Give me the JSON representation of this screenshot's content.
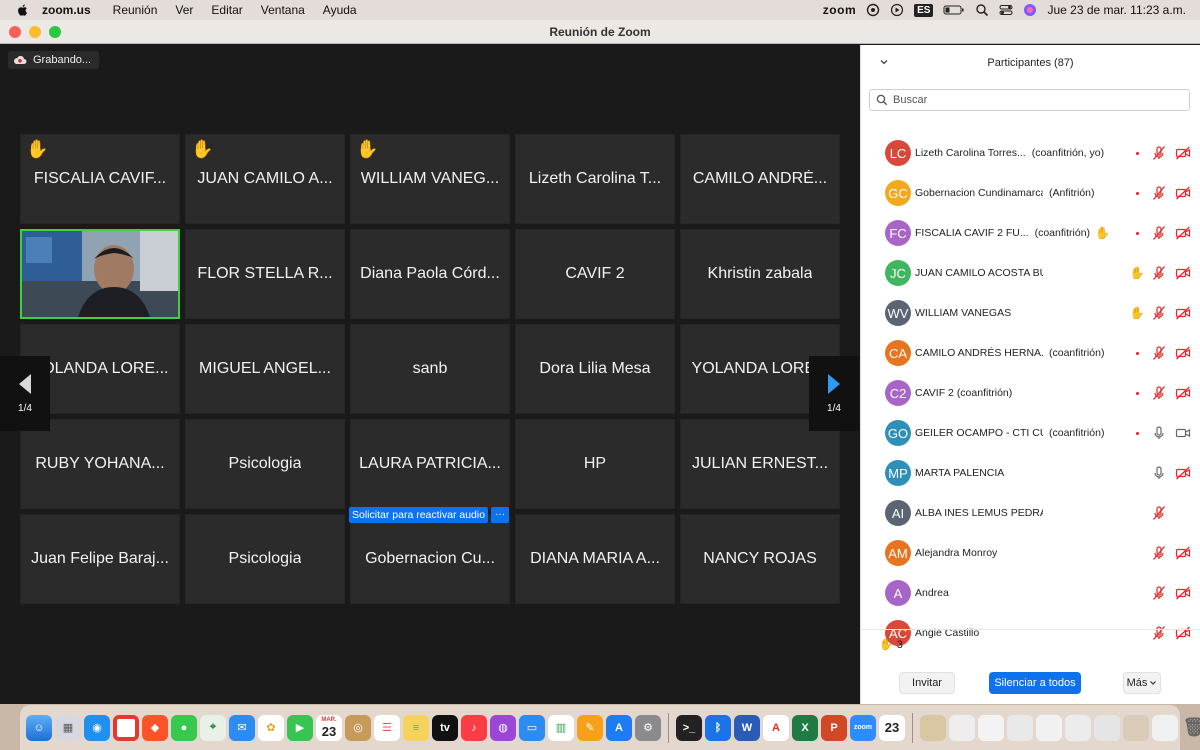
{
  "menubar": {
    "app": "zoom.us",
    "items": [
      "Reunión",
      "Ver",
      "Editar",
      "Ventana",
      "Ayuda"
    ],
    "status_zoom": "zoom",
    "input_lang": "ES",
    "datetime": "Jue 23 de mar.  11:23 a.m."
  },
  "window": {
    "title": "Reunión de Zoom",
    "recording_label": "Grabando..."
  },
  "grid": {
    "tiles": [
      {
        "name": "FISCALIA CAVIF...",
        "hand": true
      },
      {
        "name": "JUAN CAMILO A...",
        "hand": true
      },
      {
        "name": "WILLIAM VANEG...",
        "hand": true
      },
      {
        "name": "Lizeth Carolina T...",
        "hand": false
      },
      {
        "name": "CAMILO ANDRÉ...",
        "hand": false
      },
      {
        "name": "",
        "video": true
      },
      {
        "name": "FLOR STELLA R...",
        "hand": false
      },
      {
        "name": "Diana Paola Córd...",
        "hand": false
      },
      {
        "name": "CAVIF 2",
        "hand": false
      },
      {
        "name": "Khristin zabala",
        "hand": false
      },
      {
        "name": "YOLANDA LORE...",
        "hand": false
      },
      {
        "name": "MIGUEL ANGEL...",
        "hand": false
      },
      {
        "name": "sanb",
        "hand": false
      },
      {
        "name": "Dora Lilia Mesa",
        "hand": false
      },
      {
        "name": "YOLANDA LORE...",
        "hand": false
      },
      {
        "name": "RUBY YOHANA...",
        "hand": false
      },
      {
        "name": "Psicologia",
        "hand": false
      },
      {
        "name": "LAURA PATRICIA...",
        "hand": false
      },
      {
        "name": "HP",
        "hand": false
      },
      {
        "name": "JULIAN ERNEST...",
        "hand": false
      },
      {
        "name": "Juan Felipe Baraj...",
        "hand": false
      },
      {
        "name": "Psicologia",
        "hand": false
      },
      {
        "name": "Gobernacion Cu...",
        "hand": false,
        "request_audio": "Solicitar para reactivar audio",
        "more": "···"
      },
      {
        "name": "DIANA MARIA A...",
        "hand": false
      },
      {
        "name": "NANCY ROJAS",
        "hand": false
      }
    ],
    "page_left": "1/4",
    "page_right": "1/4"
  },
  "panel": {
    "title": "Participantes (87)",
    "search_placeholder": "Buscar",
    "participants": [
      {
        "initials": "LC",
        "color": "#d9493a",
        "name": "Lizeth Carolina Torres...",
        "role": "(coanfitrión, yo)",
        "hand": false,
        "dot": true,
        "mic": "muted",
        "cam": "off"
      },
      {
        "initials": "GC",
        "color": "#f4a81d",
        "name": "Gobernacion Cundinamarca...",
        "role": "(Anfitrión)",
        "hand": false,
        "dot": true,
        "mic": "muted",
        "cam": "off"
      },
      {
        "initials": "FC",
        "color": "#a865c9",
        "name": "FISCALIA CAVIF 2 FU...",
        "role": "(coanfitrión)",
        "hand": true,
        "dot": true,
        "mic": "muted",
        "cam": "off"
      },
      {
        "initials": "JC",
        "color": "#3fb75e",
        "name": "JUAN CAMILO ACOSTA BUELVAS",
        "role": "",
        "hand": false,
        "hand_right": true,
        "dot": false,
        "mic": "muted",
        "cam": "off"
      },
      {
        "initials": "WV",
        "color": "#5b6472",
        "name": "WILLIAM VANEGAS",
        "role": "",
        "hand": false,
        "hand_right": true,
        "dot": false,
        "mic": "muted",
        "cam": "off"
      },
      {
        "initials": "CA",
        "color": "#e8741f",
        "name": "CAMILO ANDRÉS HERNA...",
        "role": "(coanfitrión)",
        "hand": false,
        "dot": true,
        "mic": "muted",
        "cam": "off"
      },
      {
        "initials": "C2",
        "color": "#a865c9",
        "name": "CAVIF 2 (coanfitrión)",
        "role": "",
        "hand": false,
        "dot": true,
        "mic": "muted",
        "cam": "off"
      },
      {
        "initials": "GO",
        "color": "#2e8fb8",
        "name": "GEILER OCAMPO - CTI CU...",
        "role": "(coanfitrión)",
        "hand": false,
        "dot": true,
        "mic": "on",
        "cam": "on"
      },
      {
        "initials": "MP",
        "color": "#2e8fb8",
        "name": "MARTA PALENCIA",
        "role": "",
        "hand": false,
        "dot": false,
        "mic": "on",
        "cam": "off"
      },
      {
        "initials": "AI",
        "color": "#5b6472",
        "name": "ALBA INES LEMUS PEDRAZA",
        "role": "",
        "hand": false,
        "dot": false,
        "mic": "muted",
        "cam": "none"
      },
      {
        "initials": "AM",
        "color": "#e8741f",
        "name": "Alejandra Monroy",
        "role": "",
        "hand": false,
        "dot": false,
        "mic": "muted",
        "cam": "off"
      },
      {
        "initials": "A",
        "color": "#a865c9",
        "name": "Andrea",
        "role": "",
        "hand": false,
        "dot": false,
        "mic": "muted",
        "cam": "off"
      },
      {
        "initials": "AC",
        "color": "#d9493a",
        "name": "Angie Castillo",
        "role": "",
        "hand": false,
        "dot": false,
        "mic": "muted",
        "cam": "off"
      }
    ],
    "raised_count": "3",
    "invite_label": "Invitar",
    "mute_all_label": "Silenciar a todos",
    "more_label": "Más"
  },
  "dock": {
    "calendar_month": "MAR.",
    "calendar_day": "23",
    "calendar2_day": "23"
  },
  "colors": {
    "zoom_blue": "#0e72ed",
    "active_speaker": "#3fd03f",
    "muted_red": "#e02828"
  }
}
